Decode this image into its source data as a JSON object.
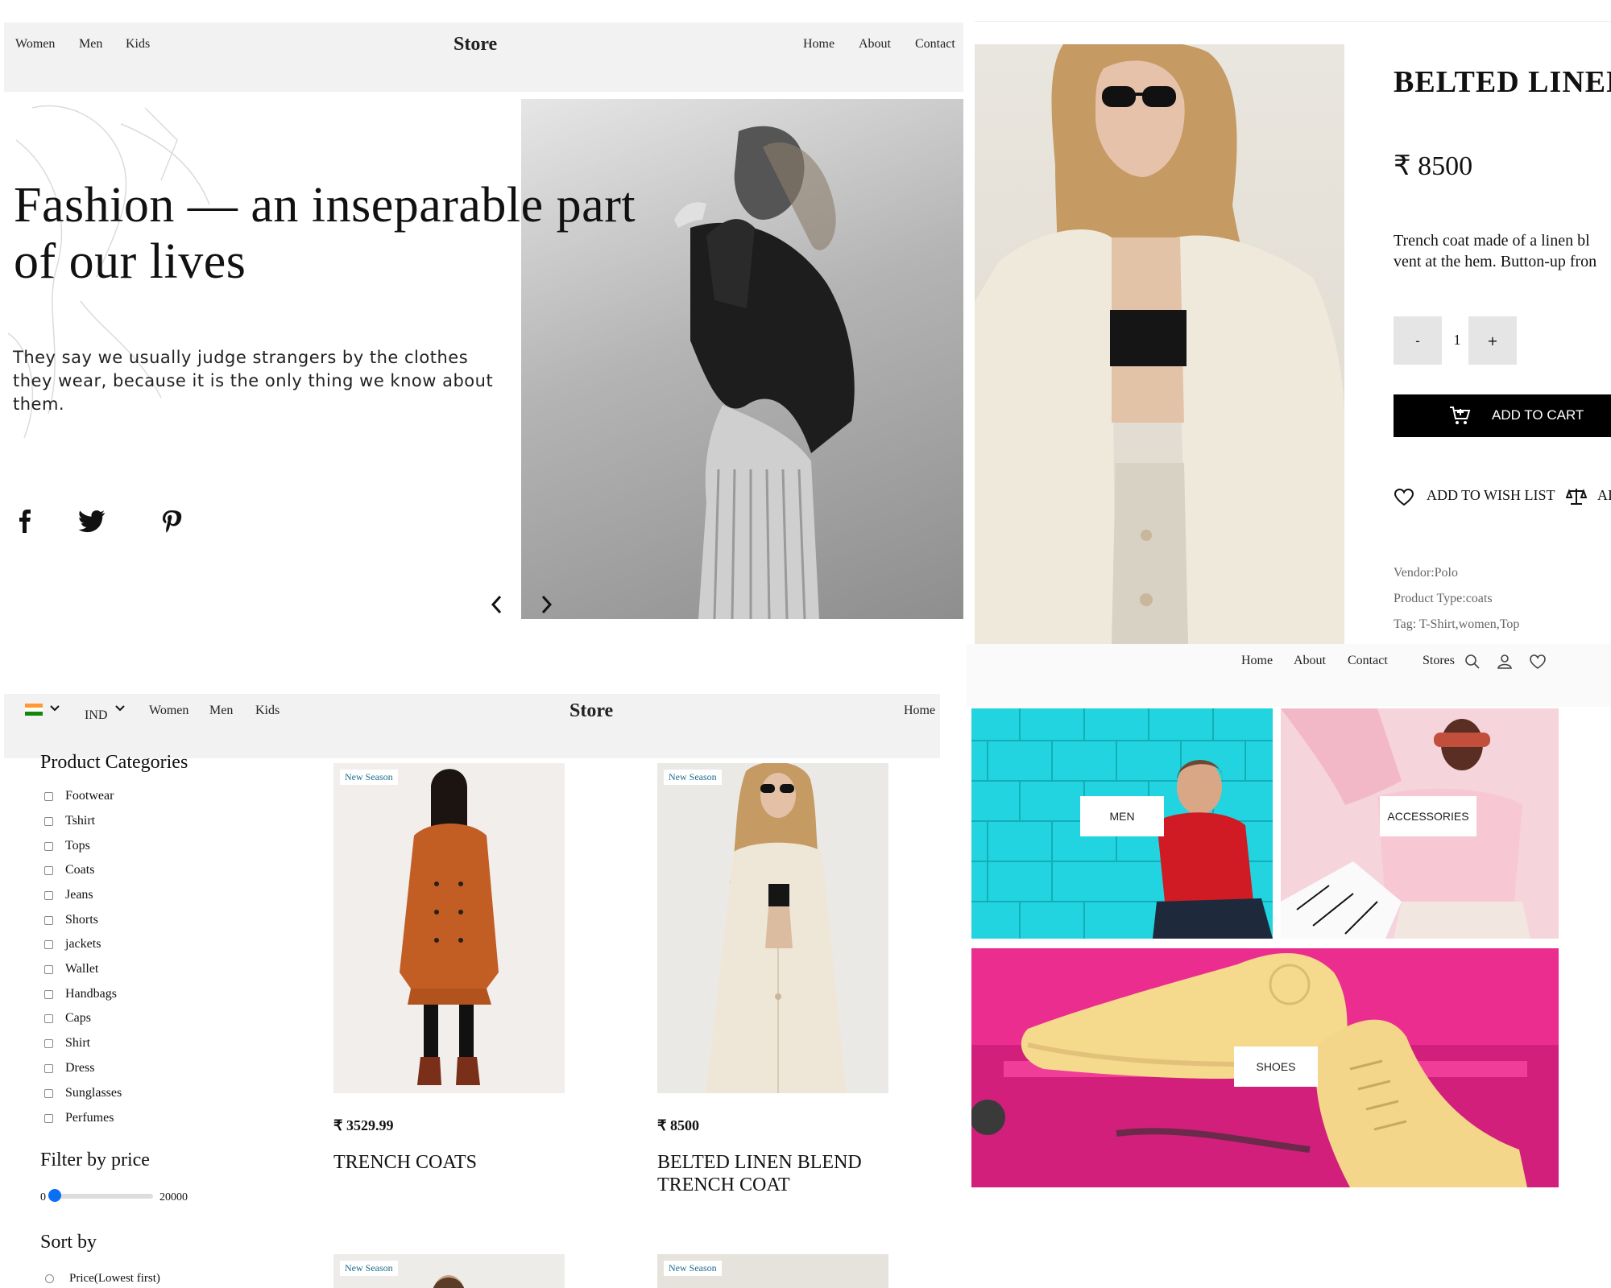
{
  "hero": {
    "nav_left": [
      "Women",
      "Men",
      "Kids"
    ],
    "brand": "Store",
    "nav_right": [
      "Home",
      "About",
      "Contact"
    ],
    "title": "Fashion — an inseparable part of our lives",
    "text": "They say we usually judge strangers by the clothes they wear, because it is the only thing we know about them.",
    "social_icons": [
      "facebook-icon",
      "twitter-icon",
      "pinterest-icon"
    ],
    "carousel_icons": [
      "chevron-left-icon",
      "chevron-right-icon"
    ]
  },
  "product": {
    "title": "BELTED LINEN",
    "price": "₹ 8500",
    "description_line1": "Trench coat made of a linen bl",
    "description_line2": "vent at the hem. Button-up fron",
    "qty_minus": "-",
    "qty_value": "1",
    "qty_plus": "+",
    "add_to_cart": "ADD TO CART",
    "add_to_wishlist": "ADD TO WISH LIST",
    "compare_label": "AI",
    "vendor": "Vendor:Polo",
    "product_type": "Product Type:coats",
    "tags": "Tag: T-Shirt,women,Top"
  },
  "listing": {
    "currency": "IND",
    "nav_left": [
      "Women",
      "Men",
      "Kids"
    ],
    "brand": "Store",
    "nav_right": [
      "Home"
    ],
    "categories_title": "Product Categories",
    "categories": [
      "Footwear",
      "Tshirt",
      "Tops",
      "Coats",
      "Jeans",
      "Shorts",
      "jackets",
      "Wallet",
      "Handbags",
      "Caps",
      "Shirt",
      "Dress",
      "Sunglasses",
      "Perfumes"
    ],
    "filter_title": "Filter by price",
    "price_min": "0",
    "price_max": "20000",
    "price_slider_value": 0,
    "sort_title": "Sort by",
    "sort_options": [
      "Price(Lowest first)"
    ],
    "badge": "New Season",
    "products": [
      {
        "price": "₹ 3529.99",
        "name": "TRENCH COATS"
      },
      {
        "price": "₹ 8500",
        "name": "BELTED LINEN BLEND TRENCH COAT"
      }
    ]
  },
  "categories_page": {
    "nav": [
      "Home",
      "About",
      "Contact",
      "Stores"
    ],
    "nav_icons": [
      "search-icon",
      "user-icon",
      "heart-icon"
    ],
    "tiles": [
      "MEN",
      "ACCESSORIES",
      "SHOES"
    ]
  }
}
